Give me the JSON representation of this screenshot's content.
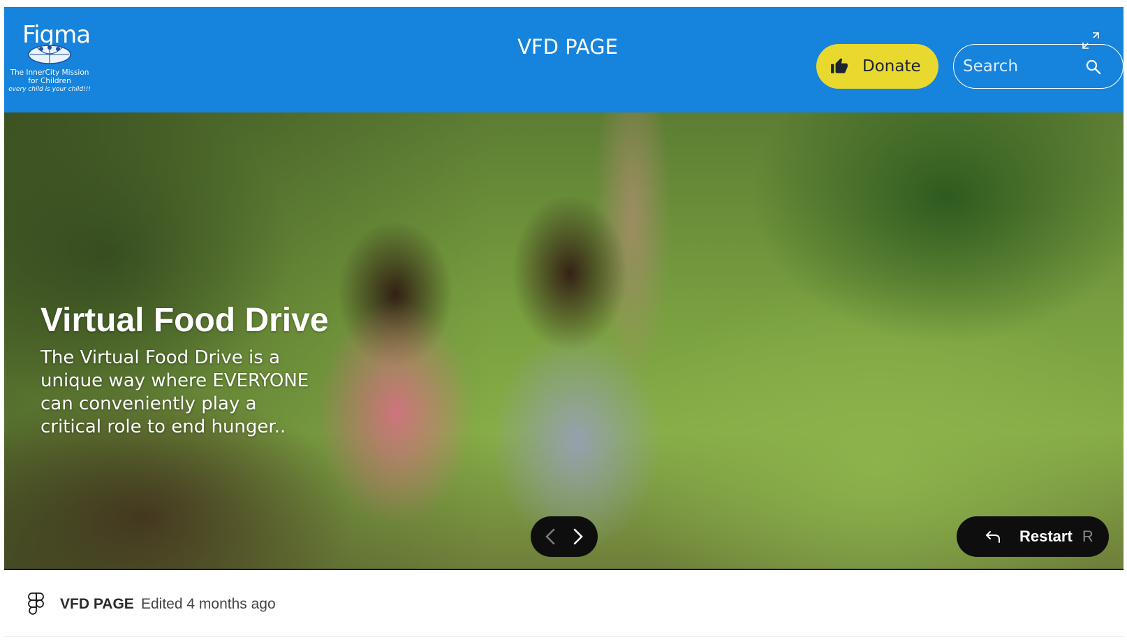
{
  "header": {
    "brand_word": "Figma",
    "logo": {
      "org_name_line1": "The InnerCity Mission",
      "org_name_line2": "for Children",
      "tagline": "every child is your child!!!"
    },
    "page_title": "VFD PAGE",
    "donate_label": "Donate",
    "search": {
      "placeholder": "Search",
      "value": ""
    }
  },
  "hero": {
    "heading": "Virtual Food Drive",
    "body": "The Virtual Food Drive is a unique way where EVERYONE can conveniently play a critical role to end hunger..",
    "restart_label": "Restart",
    "restart_key": "R"
  },
  "footer": {
    "file_name": "VFD PAGE",
    "edited_text": "Edited 4 months ago"
  },
  "colors": {
    "header_bg": "#1683dd",
    "donate_bg": "#e9d92f",
    "control_bg": "#0e0e0e"
  },
  "icons": [
    "thumbs-up-icon",
    "search-icon",
    "expand-icon",
    "chevron-left-icon",
    "chevron-right-icon",
    "restart-arrow-icon",
    "figma-icon"
  ]
}
